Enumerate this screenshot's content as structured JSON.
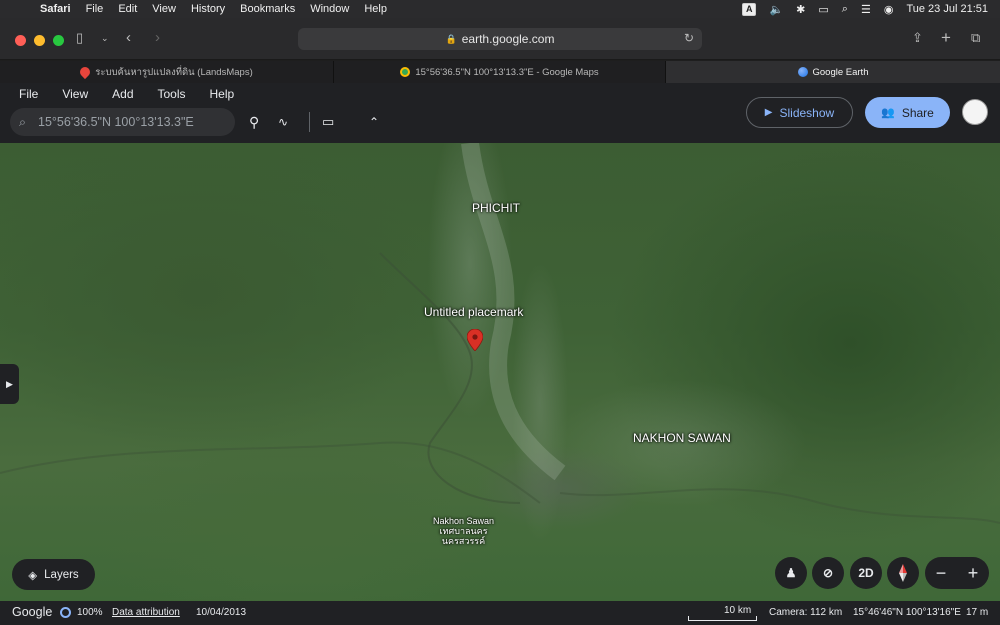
{
  "menubar": {
    "app": "Safari",
    "items": [
      "File",
      "Edit",
      "View",
      "History",
      "Bookmarks",
      "Window",
      "Help"
    ],
    "input_badge": "A",
    "datetime": "Tue 23 Jul  21:51"
  },
  "toolbar": {
    "url": "earth.google.com"
  },
  "tabs": [
    {
      "title": "ระบบค้นหารูปแปลงที่ดิน (LandsMaps)",
      "icon": "map-pin-icon",
      "color": "#e8453c"
    },
    {
      "title": "15°56'36.5\"N 100°13'13.3\"E - Google Maps",
      "icon": "google-maps-icon",
      "color": "#34a853"
    },
    {
      "title": "Google Earth",
      "icon": "google-earth-icon",
      "color": "#4285f4"
    }
  ],
  "earth": {
    "menus": [
      "File",
      "View",
      "Add",
      "Tools",
      "Help"
    ],
    "search_value": "15°56'36.5\"N 100°13'13.3\"E",
    "slideshow_label": "Slideshow",
    "share_label": "Share"
  },
  "map": {
    "labels": {
      "phichit": "PHICHIT",
      "placemark": "Untitled placemark",
      "nakhon_sawan_province": "NAKHON SAWAN",
      "city_en": "Nakhon Sawan",
      "city_th1": "เทศบาลนคร",
      "city_th2": "นครสวรรค์"
    },
    "layers_label": "Layers",
    "view_mode": "2D"
  },
  "status": {
    "brand": "Google",
    "load_percent": "100%",
    "attribution": "Data attribution",
    "imagery_date": "10/04/2013",
    "scale_label": "10 km",
    "camera": "Camera: 112 km",
    "coordinates": "15°46'46\"N 100°13'16\"E",
    "elevation": "17 m"
  },
  "colors": {
    "accent": "#8ab4f8",
    "pin": "#d93025",
    "panel": "#202124"
  }
}
